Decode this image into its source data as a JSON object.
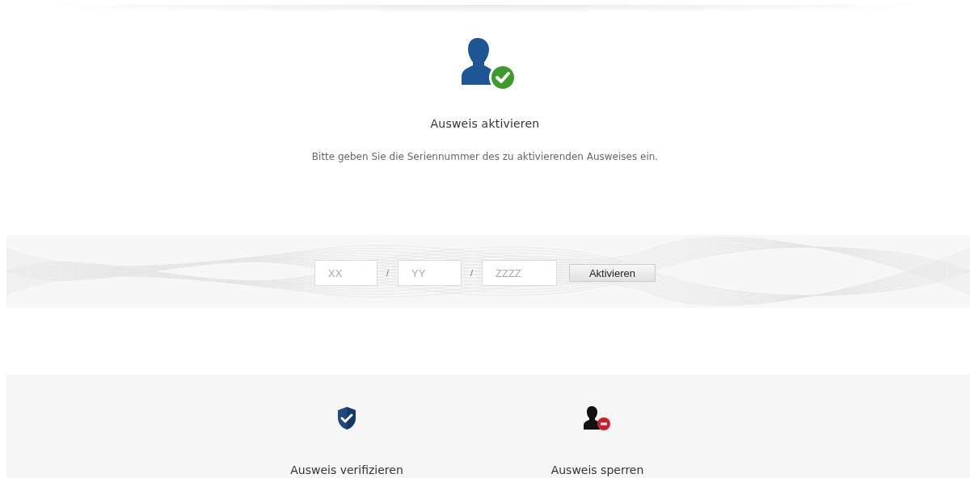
{
  "header": {
    "title": "Ausweis aktivieren",
    "subtitle": "Bitte geben Sie die Seriennummer des zu aktivierenden Ausweises ein."
  },
  "form": {
    "fields": [
      {
        "placeholder": "XX"
      },
      {
        "placeholder": "YY"
      },
      {
        "placeholder": "ZZZZ"
      }
    ],
    "separators": [
      "/",
      "/"
    ],
    "button": "Aktivieren"
  },
  "actions": [
    {
      "kind": "verify",
      "label": "Ausweis verifizieren"
    },
    {
      "kind": "block",
      "label": "Ausweis sperren"
    }
  ]
}
